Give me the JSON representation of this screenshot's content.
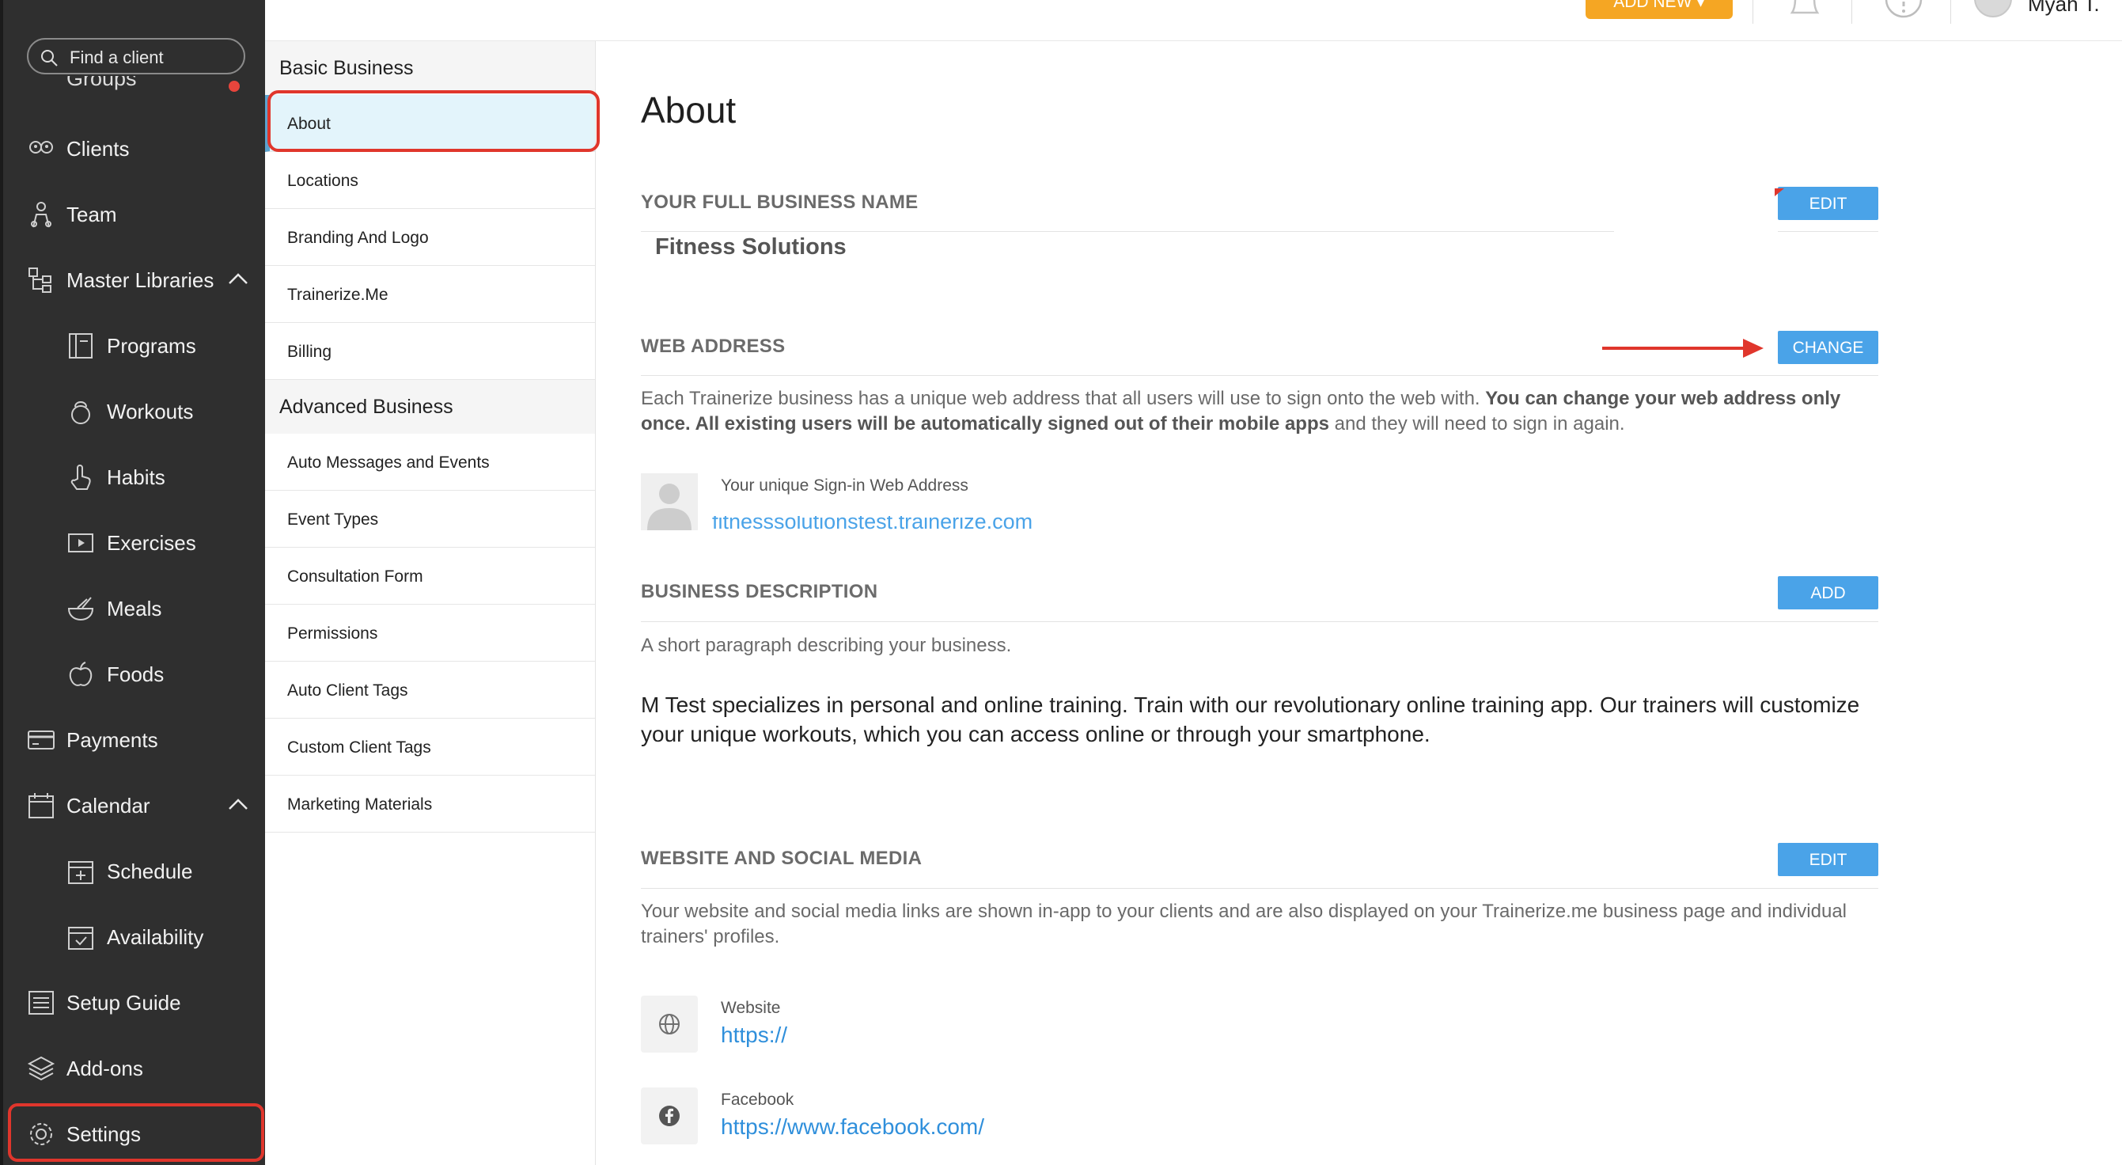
{
  "sidebar": {
    "search_placeholder": "Find a client",
    "groups_peek": "Groups",
    "items": [
      {
        "label": "Clients"
      },
      {
        "label": "Team"
      },
      {
        "label": "Master Libraries"
      },
      {
        "label": "Programs"
      },
      {
        "label": "Workouts"
      },
      {
        "label": "Habits"
      },
      {
        "label": "Exercises"
      },
      {
        "label": "Meals"
      },
      {
        "label": "Foods"
      },
      {
        "label": "Payments"
      },
      {
        "label": "Calendar"
      },
      {
        "label": "Schedule"
      },
      {
        "label": "Availability"
      },
      {
        "label": "Setup Guide"
      },
      {
        "label": "Add-ons"
      },
      {
        "label": "Settings"
      }
    ]
  },
  "topbar": {
    "add_new": "ADD NEW ▾",
    "user_name": "Myah T."
  },
  "menu": {
    "basic_title": "Basic Business",
    "basic_items": [
      "About",
      "Locations",
      "Branding And Logo",
      "Trainerize.Me",
      "Billing"
    ],
    "advanced_title": "Advanced Business",
    "advanced_items": [
      "Auto Messages and Events",
      "Event Types",
      "Consultation Form",
      "Permissions",
      "Auto Client Tags",
      "Custom Client Tags",
      "Marketing Materials"
    ]
  },
  "main": {
    "title": "About",
    "full_name": {
      "heading": "YOUR FULL BUSINESS NAME",
      "button": "EDIT",
      "value": "Fitness Solutions"
    },
    "web_address": {
      "heading": "WEB ADDRESS",
      "button": "CHANGE",
      "text_plain_1": "Each Trainerize business has a unique web address that all users will use to sign onto the web with. ",
      "text_bold": "You can change your web address only once. All existing users will be automatically signed out of their mobile apps",
      "text_plain_2": " and they will need to sign in again.",
      "signin_label": "Your unique Sign-in Web Address",
      "signin_url": "fitnesssolutionstest.trainerize.com"
    },
    "description": {
      "heading": "BUSINESS DESCRIPTION",
      "button": "ADD",
      "hint": "A short paragraph describing your business.",
      "text": "M Test specializes in personal and online training. Train with our revolutionary online training app. Our trainers will customize your unique workouts, which you can access online or through your smartphone."
    },
    "social": {
      "heading": "WEBSITE AND SOCIAL MEDIA",
      "button": "EDIT",
      "hint": "Your website and social media links are shown in-app to your clients and are also displayed on your Trainerize.me business page and individual trainers' profiles.",
      "website_label": "Website",
      "website_url": "https://",
      "facebook_label": "Facebook",
      "facebook_url": "https://www.facebook.com/"
    }
  },
  "colors": {
    "sidebar_bg": "#2f2f2f",
    "accent_blue": "#4aa3e8",
    "add_new_orange": "#f5a623",
    "highlight_red": "#e0362c",
    "active_menu_bg": "#e3f4fb"
  }
}
